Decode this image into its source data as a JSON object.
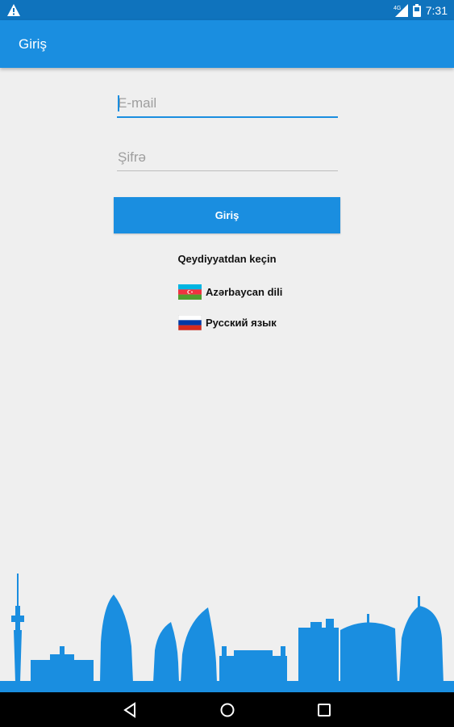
{
  "status_bar": {
    "time": "7:31",
    "network": "4G",
    "icons": [
      "warning-icon",
      "signal-icon",
      "battery-icon"
    ]
  },
  "app_bar": {
    "title": "Giriş"
  },
  "form": {
    "email_placeholder": "E-mail",
    "password_placeholder": "Şifrə",
    "login_label": "Giriş",
    "register_label": "Qeydiyyatdan keçin"
  },
  "languages": [
    {
      "label": "Azərbaycan dili",
      "flag": "azerbaijan-flag-icon"
    },
    {
      "label": "Русский язык",
      "flag": "russia-flag-icon"
    }
  ],
  "nav_bar": {
    "buttons": [
      "back-icon",
      "home-icon",
      "recents-icon"
    ]
  },
  "colors": {
    "status_bar": "#0f73bd",
    "app_bar": "#1a8ee0",
    "accent": "#1a8ee0",
    "background": "#efefef",
    "skyline": "#1a8ee0"
  }
}
